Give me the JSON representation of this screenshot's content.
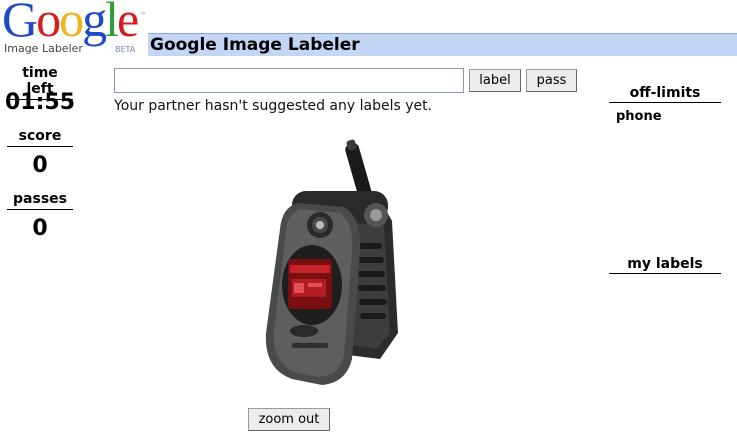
{
  "logo": {
    "word": "Google",
    "subtitle": "Image Labeler",
    "badge": "BETA",
    "trademark": "™"
  },
  "header": {
    "title": "Google Image Labeler"
  },
  "stats": {
    "time_left_label": "time left",
    "time_left_value": "01:55",
    "score_label": "score",
    "score_value": "0",
    "passes_label": "passes",
    "passes_value": "0"
  },
  "guess": {
    "value": "",
    "label_button": "label",
    "pass_button": "pass",
    "partner_message": "Your partner hasn't suggested any labels yet."
  },
  "image": {
    "subject": "flip-phone"
  },
  "controls": {
    "zoom_out": "zoom out"
  },
  "sidebar": {
    "off_limits_heading": "off-limits",
    "off_limits": [
      "phone"
    ],
    "my_labels_heading": "my labels",
    "my_labels": []
  },
  "colors": {
    "title_bar": "#c3d6f5",
    "google_blue": "#1f49c6",
    "google_red": "#d3201e",
    "google_yellow": "#f3b11b",
    "google_green": "#2f9e3a"
  }
}
